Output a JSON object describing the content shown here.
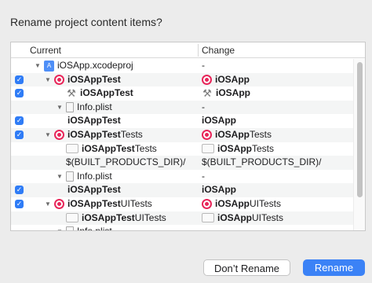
{
  "dialog": {
    "title": "Rename project content items?",
    "dont_rename_label": "Don’t Rename",
    "rename_label": "Rename"
  },
  "table": {
    "col_current": "Current",
    "col_change": "Change",
    "rows": [
      {
        "checked": false,
        "level": 0,
        "disclosure": "▼",
        "icon": "xcode-project-icon",
        "current": "iOSApp.xcodeproj",
        "current_bold": false,
        "change": "-",
        "change_icon": ""
      },
      {
        "checked": true,
        "level": 1,
        "disclosure": "▼",
        "icon": "target-icon",
        "current": "iOSAppTest",
        "current_bold": true,
        "change": "iOSApp",
        "change_icon": "target-icon",
        "change_bold": true
      },
      {
        "checked": true,
        "level": 2,
        "disclosure": "",
        "icon": "build-tool-icon",
        "current": "iOSAppTest",
        "current_bold": true,
        "change": "iOSApp",
        "change_icon": "build-tool-icon",
        "change_bold": true
      },
      {
        "checked": false,
        "level": 2,
        "disclosure": "▼",
        "icon": "plist-file-icon",
        "current": "Info.plist",
        "current_bold": false,
        "change": "-",
        "change_icon": ""
      },
      {
        "checked": true,
        "level": 3,
        "disclosure": "",
        "icon": "",
        "current": "iOSAppTest",
        "current_bold": true,
        "change": "iOSApp",
        "change_icon": "",
        "change_bold": true
      },
      {
        "checked": true,
        "level": 1,
        "disclosure": "▼",
        "icon": "target-icon",
        "current_bold_part": "iOSAppTest",
        "current_rest": "Tests",
        "change_bold_part": "iOSApp",
        "change_rest": "Tests",
        "change_icon": "target-icon"
      },
      {
        "checked": false,
        "level": 2,
        "disclosure": "",
        "icon": "folder-icon",
        "current_bold_part": "iOSAppTest",
        "current_rest": "Tests",
        "change_bold_part": "iOSApp",
        "change_rest": "Tests",
        "change_icon": "folder-icon"
      },
      {
        "checked": false,
        "level": 2,
        "disclosure": "",
        "icon": "",
        "current": "$(BUILT_PRODUCTS_DIR)/",
        "current_bold": false,
        "change": "$(BUILT_PRODUCTS_DIR)/",
        "change_icon": ""
      },
      {
        "checked": false,
        "level": 2,
        "disclosure": "▼",
        "icon": "plist-file-icon",
        "current": "Info.plist",
        "current_bold": false,
        "change": "-",
        "change_icon": ""
      },
      {
        "checked": true,
        "level": 3,
        "disclosure": "",
        "icon": "",
        "current": "iOSAppTest",
        "current_bold": true,
        "change": "iOSApp",
        "change_icon": "",
        "change_bold": true
      },
      {
        "checked": true,
        "level": 1,
        "disclosure": "▼",
        "icon": "target-icon",
        "current_bold_part": "iOSAppTest",
        "current_rest": "UITests",
        "change_bold_part": "iOSApp",
        "change_rest": "UITests",
        "change_icon": "target-icon"
      },
      {
        "checked": false,
        "level": 2,
        "disclosure": "",
        "icon": "folder-icon",
        "current_bold_part": "iOSAppTest",
        "current_rest": "UITests",
        "change_bold_part": "iOSApp",
        "change_rest": "UITests",
        "change_icon": "folder-icon"
      },
      {
        "checked": false,
        "level": 2,
        "disclosure": "▼",
        "icon": "plist-file-icon",
        "current": "Info.plist",
        "current_bold": false,
        "change": "",
        "change_icon": ""
      }
    ]
  },
  "colors": {
    "accent": "#3b82f6",
    "target_red": "#e8265a"
  }
}
